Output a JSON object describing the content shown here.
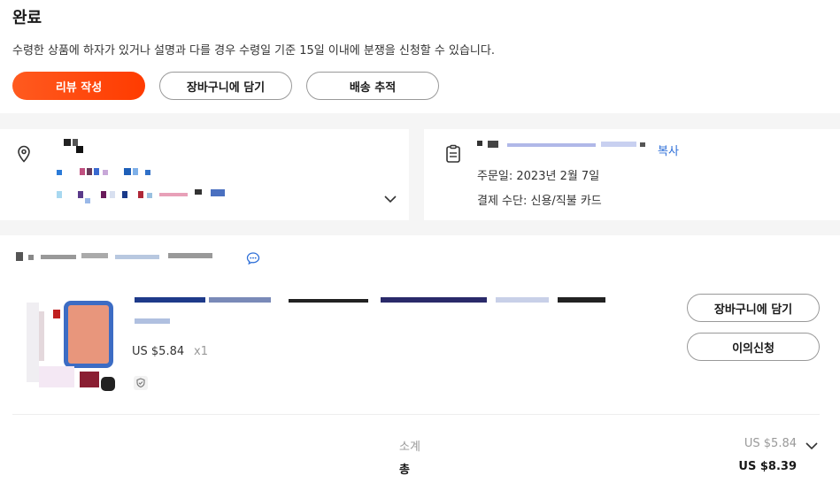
{
  "header": {
    "status_title": "완료",
    "notice": "수령한 상품에 하자가 있거나 설명과 다를 경우 수령일 기준 15일 이내에 분쟁을 신청할 수 있습니다.",
    "buttons": {
      "review": "리뷰 작성",
      "add_to_cart": "장바구니에 담기",
      "track": "배송 추적"
    }
  },
  "address_card": {
    "icon": "location-pin-icon",
    "expand_icon": "chevron-down-icon"
  },
  "order_card": {
    "icon": "receipt-icon",
    "copy_label": "복사",
    "order_date": "주문일: 2023년 2월 7일",
    "payment_method": "결제 수단: 신용/직불 카드"
  },
  "item": {
    "price": "US $5.84",
    "quantity": "x1",
    "buttons": {
      "add_to_cart": "장바구니에 담기",
      "dispute": "이의신청"
    }
  },
  "summary": {
    "subtotal_label": "소계",
    "subtotal_value": "US $5.84",
    "total_label": "총",
    "total_value": "US $8.39"
  },
  "colors": {
    "accent": "#ff4a0d",
    "link": "#2e6fd8"
  }
}
